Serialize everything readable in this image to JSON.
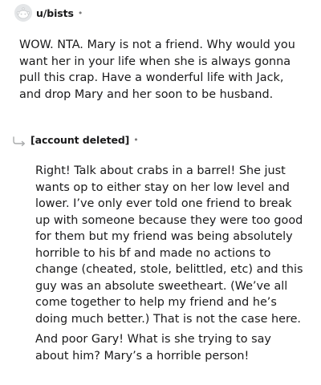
{
  "comment1": {
    "username": "u/bists",
    "separator": "•",
    "avatar_icon": "snoo-avatar-icon",
    "body": "WOW. NTA. Mary is not a friend. Why would you want her in your life when she is always gonna pull this crap. Have a wonderful life with Jack, and drop Mary and her soon to be husband."
  },
  "comment2": {
    "username": "[account deleted]",
    "separator": "•",
    "reply_icon": "reply-arrow-icon",
    "paragraphs": [
      "Right! Talk about crabs in a barrel! She just wants op to either stay on her low level and lower. I’ve only ever told one friend to break up with someone because they were too good for them but my friend was being absolutely horrible to his bf and made no actions to change (cheated, stole, belittled, etc) and this guy was an absolute sweetheart. (We’ve all come together to help my friend and he’s doing much better.) That is not the case here.",
      "And poor Gary! What is she trying to say about him? Mary’s a horrible person!"
    ]
  },
  "colors": {
    "text": "#1a1a1b",
    "meta": "#7c7c7c",
    "avatar_bg": "#e4e6e8",
    "reply_arrow": "#a8aaab"
  }
}
